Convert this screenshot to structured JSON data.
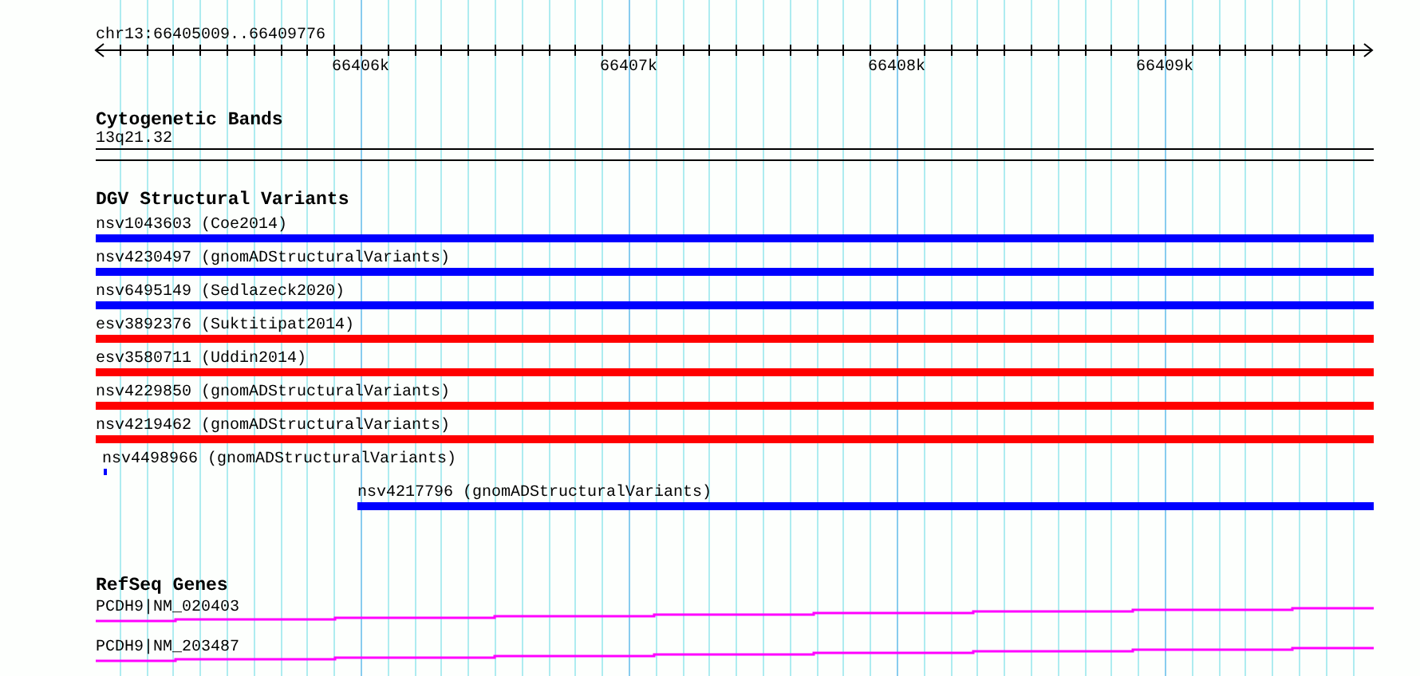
{
  "ruler": {
    "location": "chr13:66405009..66409776",
    "tick_labels": [
      "66406k",
      "66407k",
      "66408k",
      "66409k"
    ]
  },
  "tracks": [
    {
      "kind": "bands",
      "title": "Cytogenetic Bands",
      "features": [
        {
          "label": "13q21.32"
        }
      ]
    },
    {
      "kind": "variants",
      "title": "DGV Structural Variants",
      "features": [
        {
          "label": "nsv1043603 (Coe2014)",
          "color": "#0000ff"
        },
        {
          "label": "nsv4230497 (gnomADStructuralVariants)",
          "color": "#0000ff"
        },
        {
          "label": "nsv6495149 (Sedlazeck2020)",
          "color": "#0000ff"
        },
        {
          "label": "esv3892376 (Suktitipat2014)",
          "color": "#ff0000"
        },
        {
          "label": "esv3580711 (Uddin2014)",
          "color": "#ff0000"
        },
        {
          "label": "nsv4229850 (gnomADStructuralVariants)",
          "color": "#ff0000"
        },
        {
          "label": "nsv4219462 (gnomADStructuralVariants)",
          "color": "#ff0000"
        },
        {
          "label": "nsv4498966 (gnomADStructuralVariants)",
          "color": "#0000ff"
        },
        {
          "label": "nsv4217796 (gnomADStructuralVariants)",
          "color": "#0000ff"
        }
      ]
    },
    {
      "kind": "genes",
      "title": "RefSeq Genes",
      "features": [
        {
          "label": "PCDH9|NM_020403"
        },
        {
          "label": "PCDH9|NM_203487"
        }
      ]
    }
  ]
}
